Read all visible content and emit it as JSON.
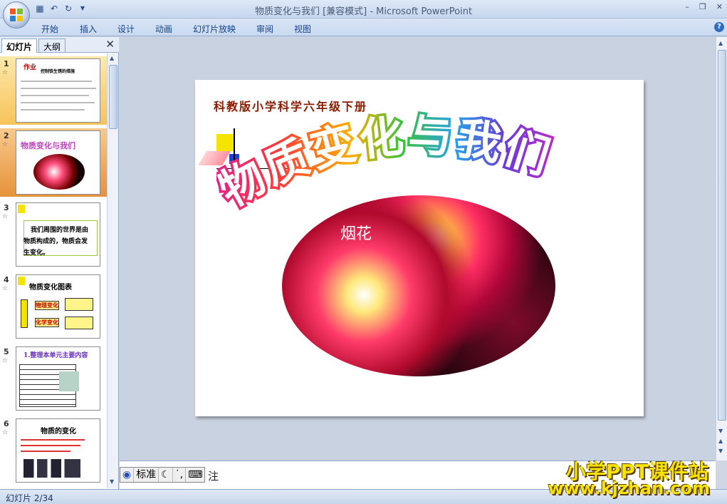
{
  "window": {
    "title": "物质变化与我们 [兼容模式] - Microsoft PowerPoint"
  },
  "ribbon": {
    "tabs": [
      "开始",
      "插入",
      "设计",
      "动画",
      "幻灯片放映",
      "审阅",
      "视图"
    ]
  },
  "left_pane": {
    "tabs": [
      "幻灯片",
      "大纲"
    ],
    "slides": [
      {
        "num": "1",
        "title": "作业",
        "subtitle": "控制铁生锈的措施"
      },
      {
        "num": "2",
        "title": "物质变化与我们"
      },
      {
        "num": "3",
        "text_lines": [
          "我们周围的世界是由",
          "物质构成的，物质会发",
          "生变化。"
        ],
        "highlight": "物质"
      },
      {
        "num": "4",
        "title": "物质变化图表",
        "labels": [
          "物理变化",
          "化学变化"
        ]
      },
      {
        "num": "5",
        "title": "1.整理本单元主要内容"
      },
      {
        "num": "6",
        "title": "物质的变化"
      }
    ]
  },
  "slide": {
    "subtitle": "科教版小学科学六年级下册",
    "title": "物质变化与我们",
    "image_caption": "烟花"
  },
  "notes": {
    "label": "注"
  },
  "ime": {
    "mode": "标准"
  },
  "status": {
    "slide_counter": "幻灯片 2/34"
  },
  "watermark": {
    "line1": "小学PPT课件站",
    "line2": "www.kjzhan.com"
  },
  "colors": {
    "accent": "#15428b",
    "selected_slide": "#e6923a",
    "watermark": "#f6e400"
  }
}
